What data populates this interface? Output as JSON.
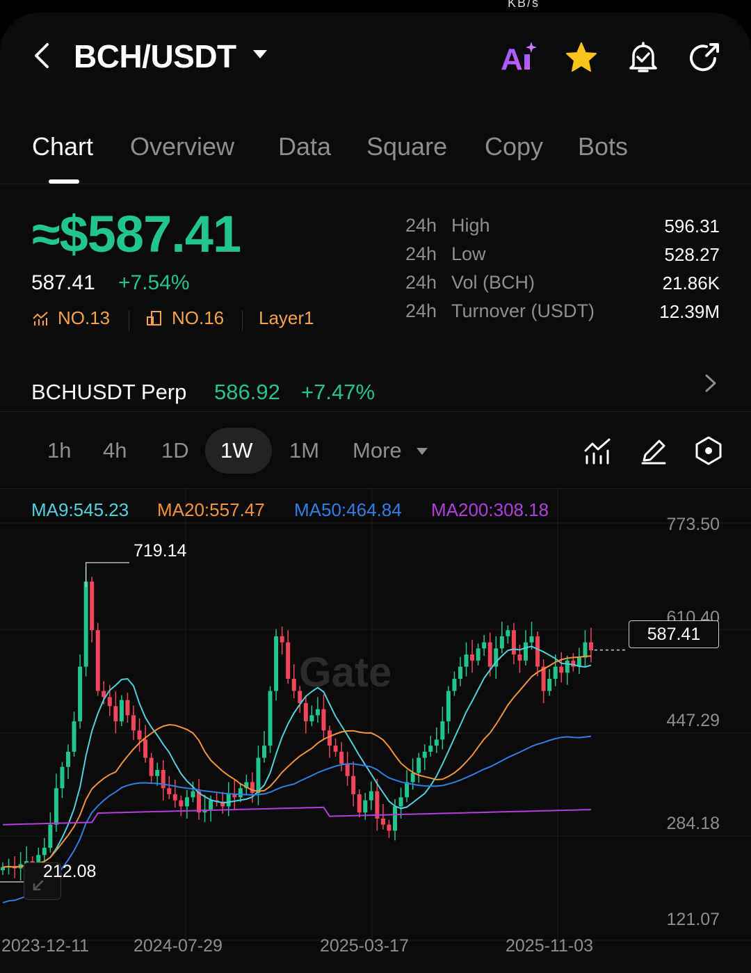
{
  "status_bar": {
    "text": "KB/s"
  },
  "header": {
    "pair": "BCH/USDT"
  },
  "tabs": [
    {
      "label": "Chart",
      "active": true
    },
    {
      "label": "Overview"
    },
    {
      "label": "Data"
    },
    {
      "label": "Square"
    },
    {
      "label": "Copy"
    },
    {
      "label": "Bots"
    }
  ],
  "price": {
    "approx": "≈$587.41",
    "last": "587.41",
    "change": "+7.54%",
    "ranks": [
      "NO.13",
      "NO.16"
    ],
    "category": "Layer1"
  },
  "stats": [
    {
      "period": "24h",
      "key": "High",
      "value": "596.31"
    },
    {
      "period": "24h",
      "key": "Low",
      "value": "528.27"
    },
    {
      "period": "24h",
      "key": "Vol (BCH)",
      "value": "21.86K"
    },
    {
      "period": "24h",
      "key": "Turnover (USDT)",
      "value": "12.39M"
    }
  ],
  "perp": {
    "name": "BCHUSDT Perp",
    "price": "586.92",
    "change": "+7.47%"
  },
  "intervals": {
    "items": [
      "1h",
      "4h",
      "1D",
      "1W",
      "1M"
    ],
    "active": "1W",
    "more": "More"
  },
  "ma": {
    "ma9": "MA9:545.23",
    "ma20": "MA20:557.47",
    "ma50": "MA50:464.84",
    "ma200": "MA200:308.18"
  },
  "colors": {
    "up": "#22c58b",
    "down": "#f0465c",
    "ma9": "#4fd1e0",
    "ma20": "#f5933a",
    "ma50": "#2f7fe6",
    "ma200": "#b23fdc",
    "accent_star": "#f9c21a"
  },
  "chart_data": {
    "type": "candlestick",
    "interval": "1W",
    "y_ticks": [
      "773.50",
      "610.40",
      "447.29",
      "284.18",
      "121.07"
    ],
    "x_ticks": [
      "2023-12-11",
      "2024-07-29",
      "2025-03-17",
      "2025-11-03"
    ],
    "ylim": [
      121.07,
      773.5
    ],
    "last_price_label": "587.41",
    "high_label": "719.14",
    "low_label": "212.08",
    "watermark": "Gate"
  }
}
